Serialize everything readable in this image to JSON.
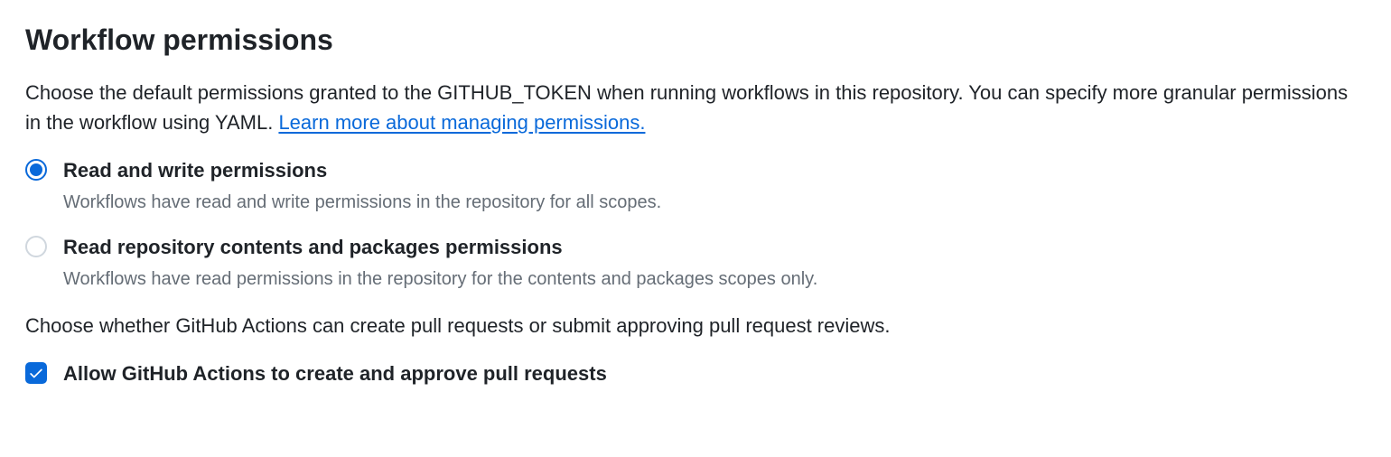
{
  "heading": "Workflow permissions",
  "description_prefix": "Choose the default permissions granted to the GITHUB_TOKEN when running workflows in this repository. You can specify more granular permissions in the workflow using YAML. ",
  "description_link": "Learn more about managing permissions.",
  "radio_options": [
    {
      "label": "Read and write permissions",
      "description": "Workflows have read and write permissions in the repository for all scopes.",
      "checked": true
    },
    {
      "label": "Read repository contents and packages permissions",
      "description": "Workflows have read permissions in the repository for the contents and packages scopes only.",
      "checked": false
    }
  ],
  "secondary_description": "Choose whether GitHub Actions can create pull requests or submit approving pull request reviews.",
  "checkbox": {
    "label": "Allow GitHub Actions to create and approve pull requests",
    "checked": true
  }
}
